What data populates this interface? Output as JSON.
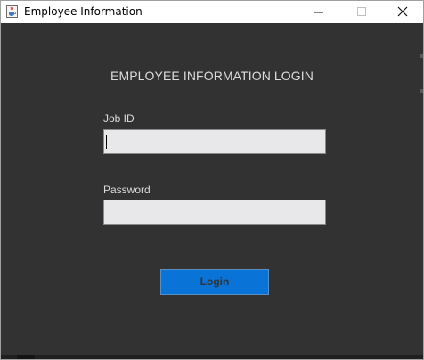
{
  "window": {
    "title": "Employee Information",
    "icon": "java-cup-icon",
    "controls": [
      "minimize",
      "maximize",
      "close"
    ]
  },
  "form": {
    "heading": "EMPLOYEE INFORMATION LOGIN",
    "job_id_label": "Job ID",
    "job_id_value": "",
    "password_label": "Password",
    "password_value": "",
    "login_label": "Login"
  },
  "colors": {
    "background": "#323232",
    "text": "#dcdcdc",
    "field": "#e8e8ea",
    "button": "#0a73d8",
    "button_text": "#333333"
  }
}
